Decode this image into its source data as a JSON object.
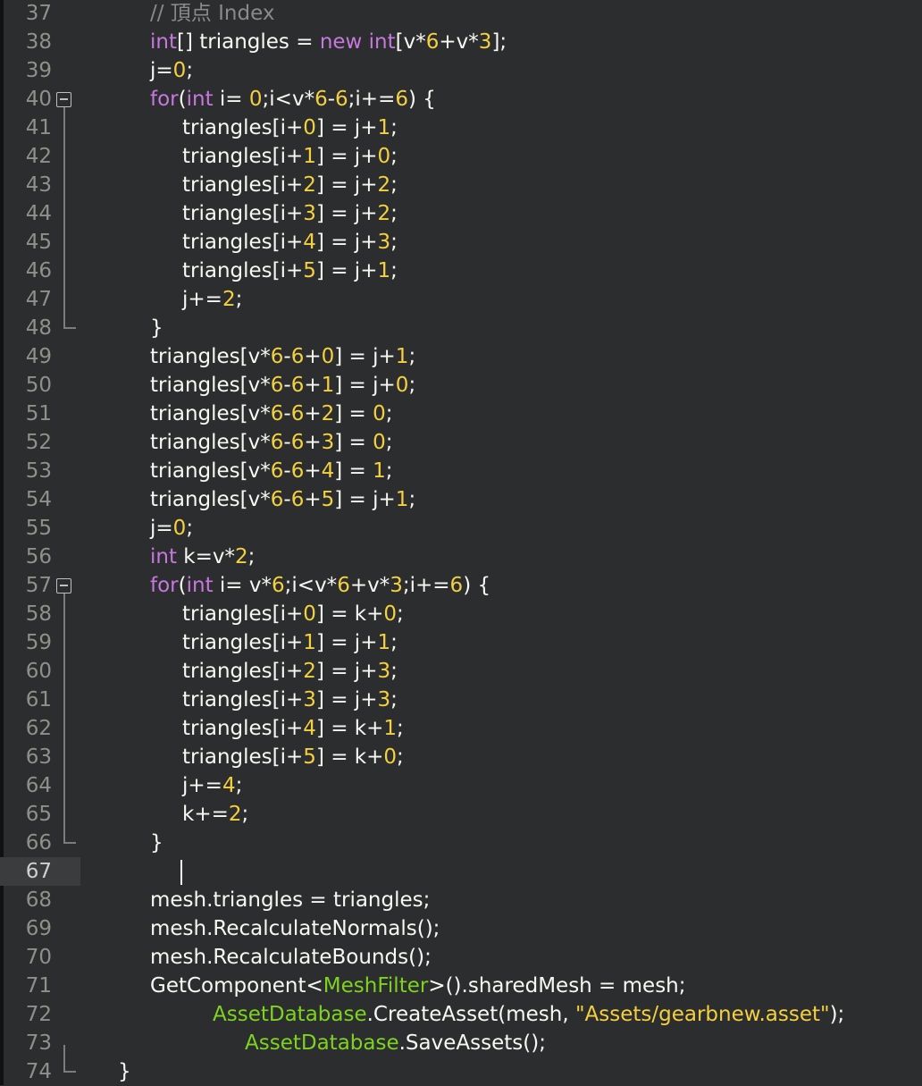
{
  "editor": {
    "current_line": 67,
    "colors": {
      "background": "#2b2d2e",
      "keyword": "#c678dd",
      "number": "#f4d03f",
      "class": "#7ed321",
      "comment": "#8a8a8a"
    },
    "icons": [
      "fold-collapse-icon"
    ],
    "lines": [
      {
        "n": "37",
        "segs": [
          [
            "cmt",
            "// 頂点 Index"
          ]
        ]
      },
      {
        "n": "38",
        "segs": [
          [
            "kw",
            "int"
          ],
          [
            "t",
            "[] triangles = "
          ],
          [
            "kw",
            "new"
          ],
          [
            "t",
            " "
          ],
          [
            "kw",
            "int"
          ],
          [
            "t",
            "[v*"
          ],
          [
            "num",
            "6"
          ],
          [
            "t",
            "+v*"
          ],
          [
            "num",
            "3"
          ],
          [
            "t",
            "];"
          ]
        ]
      },
      {
        "n": "39",
        "segs": [
          [
            "t",
            "j="
          ],
          [
            "num",
            "0"
          ],
          [
            "t",
            ";"
          ]
        ]
      },
      {
        "n": "40",
        "segs": [
          [
            "kw",
            "for"
          ],
          [
            "t",
            "("
          ],
          [
            "kw",
            "int"
          ],
          [
            "t",
            " i= "
          ],
          [
            "num",
            "0"
          ],
          [
            "t",
            ";i<v*"
          ],
          [
            "num",
            "6"
          ],
          [
            "t",
            "-"
          ],
          [
            "num",
            "6"
          ],
          [
            "t",
            ";i+="
          ],
          [
            "num",
            "6"
          ],
          [
            "t",
            ") {"
          ]
        ]
      },
      {
        "n": "41",
        "segs": [
          [
            "t",
            "triangles[i+"
          ],
          [
            "num",
            "0"
          ],
          [
            "t",
            "] = j+"
          ],
          [
            "num",
            "1"
          ],
          [
            "t",
            ";"
          ]
        ]
      },
      {
        "n": "42",
        "segs": [
          [
            "t",
            "triangles[i+"
          ],
          [
            "num",
            "1"
          ],
          [
            "t",
            "] = j+"
          ],
          [
            "num",
            "0"
          ],
          [
            "t",
            ";"
          ]
        ]
      },
      {
        "n": "43",
        "segs": [
          [
            "t",
            "triangles[i+"
          ],
          [
            "num",
            "2"
          ],
          [
            "t",
            "] = j+"
          ],
          [
            "num",
            "2"
          ],
          [
            "t",
            ";"
          ]
        ]
      },
      {
        "n": "44",
        "segs": [
          [
            "t",
            "triangles[i+"
          ],
          [
            "num",
            "3"
          ],
          [
            "t",
            "] = j+"
          ],
          [
            "num",
            "2"
          ],
          [
            "t",
            ";"
          ]
        ]
      },
      {
        "n": "45",
        "segs": [
          [
            "t",
            "triangles[i+"
          ],
          [
            "num",
            "4"
          ],
          [
            "t",
            "] = j+"
          ],
          [
            "num",
            "3"
          ],
          [
            "t",
            ";"
          ]
        ]
      },
      {
        "n": "46",
        "segs": [
          [
            "t",
            "triangles[i+"
          ],
          [
            "num",
            "5"
          ],
          [
            "t",
            "] = j+"
          ],
          [
            "num",
            "1"
          ],
          [
            "t",
            ";"
          ]
        ]
      },
      {
        "n": "47",
        "segs": [
          [
            "t",
            "j+="
          ],
          [
            "num",
            "2"
          ],
          [
            "t",
            ";"
          ]
        ]
      },
      {
        "n": "48",
        "segs": [
          [
            "t",
            "}"
          ]
        ]
      },
      {
        "n": "49",
        "segs": [
          [
            "t",
            "triangles[v*"
          ],
          [
            "num",
            "6"
          ],
          [
            "t",
            "-"
          ],
          [
            "num",
            "6"
          ],
          [
            "t",
            "+"
          ],
          [
            "num",
            "0"
          ],
          [
            "t",
            "] = j+"
          ],
          [
            "num",
            "1"
          ],
          [
            "t",
            ";"
          ]
        ]
      },
      {
        "n": "50",
        "segs": [
          [
            "t",
            "triangles[v*"
          ],
          [
            "num",
            "6"
          ],
          [
            "t",
            "-"
          ],
          [
            "num",
            "6"
          ],
          [
            "t",
            "+"
          ],
          [
            "num",
            "1"
          ],
          [
            "t",
            "] = j+"
          ],
          [
            "num",
            "0"
          ],
          [
            "t",
            ";"
          ]
        ]
      },
      {
        "n": "51",
        "segs": [
          [
            "t",
            "triangles[v*"
          ],
          [
            "num",
            "6"
          ],
          [
            "t",
            "-"
          ],
          [
            "num",
            "6"
          ],
          [
            "t",
            "+"
          ],
          [
            "num",
            "2"
          ],
          [
            "t",
            "] = "
          ],
          [
            "num",
            "0"
          ],
          [
            "t",
            ";"
          ]
        ]
      },
      {
        "n": "52",
        "segs": [
          [
            "t",
            "triangles[v*"
          ],
          [
            "num",
            "6"
          ],
          [
            "t",
            "-"
          ],
          [
            "num",
            "6"
          ],
          [
            "t",
            "+"
          ],
          [
            "num",
            "3"
          ],
          [
            "t",
            "] = "
          ],
          [
            "num",
            "0"
          ],
          [
            "t",
            ";"
          ]
        ]
      },
      {
        "n": "53",
        "segs": [
          [
            "t",
            "triangles[v*"
          ],
          [
            "num",
            "6"
          ],
          [
            "t",
            "-"
          ],
          [
            "num",
            "6"
          ],
          [
            "t",
            "+"
          ],
          [
            "num",
            "4"
          ],
          [
            "t",
            "] = "
          ],
          [
            "num",
            "1"
          ],
          [
            "t",
            ";"
          ]
        ]
      },
      {
        "n": "54",
        "segs": [
          [
            "t",
            "triangles[v*"
          ],
          [
            "num",
            "6"
          ],
          [
            "t",
            "-"
          ],
          [
            "num",
            "6"
          ],
          [
            "t",
            "+"
          ],
          [
            "num",
            "5"
          ],
          [
            "t",
            "] = j+"
          ],
          [
            "num",
            "1"
          ],
          [
            "t",
            ";"
          ]
        ]
      },
      {
        "n": "55",
        "segs": [
          [
            "t",
            "j="
          ],
          [
            "num",
            "0"
          ],
          [
            "t",
            ";"
          ]
        ]
      },
      {
        "n": "56",
        "segs": [
          [
            "kw",
            "int"
          ],
          [
            "t",
            " k=v*"
          ],
          [
            "num",
            "2"
          ],
          [
            "t",
            ";"
          ]
        ]
      },
      {
        "n": "57",
        "segs": [
          [
            "kw",
            "for"
          ],
          [
            "t",
            "("
          ],
          [
            "kw",
            "int"
          ],
          [
            "t",
            " i= v*"
          ],
          [
            "num",
            "6"
          ],
          [
            "t",
            ";i<v*"
          ],
          [
            "num",
            "6"
          ],
          [
            "t",
            "+v*"
          ],
          [
            "num",
            "3"
          ],
          [
            "t",
            ";i+="
          ],
          [
            "num",
            "6"
          ],
          [
            "t",
            ") {"
          ]
        ]
      },
      {
        "n": "58",
        "segs": [
          [
            "t",
            "triangles[i+"
          ],
          [
            "num",
            "0"
          ],
          [
            "t",
            "] = k+"
          ],
          [
            "num",
            "0"
          ],
          [
            "t",
            ";"
          ]
        ]
      },
      {
        "n": "59",
        "segs": [
          [
            "t",
            "triangles[i+"
          ],
          [
            "num",
            "1"
          ],
          [
            "t",
            "] = j+"
          ],
          [
            "num",
            "1"
          ],
          [
            "t",
            ";"
          ]
        ]
      },
      {
        "n": "60",
        "segs": [
          [
            "t",
            "triangles[i+"
          ],
          [
            "num",
            "2"
          ],
          [
            "t",
            "] = j+"
          ],
          [
            "num",
            "3"
          ],
          [
            "t",
            ";"
          ]
        ]
      },
      {
        "n": "61",
        "segs": [
          [
            "t",
            "triangles[i+"
          ],
          [
            "num",
            "3"
          ],
          [
            "t",
            "] = j+"
          ],
          [
            "num",
            "3"
          ],
          [
            "t",
            ";"
          ]
        ]
      },
      {
        "n": "62",
        "segs": [
          [
            "t",
            "triangles[i+"
          ],
          [
            "num",
            "4"
          ],
          [
            "t",
            "] = k+"
          ],
          [
            "num",
            "1"
          ],
          [
            "t",
            ";"
          ]
        ]
      },
      {
        "n": "63",
        "segs": [
          [
            "t",
            "triangles[i+"
          ],
          [
            "num",
            "5"
          ],
          [
            "t",
            "] = k+"
          ],
          [
            "num",
            "0"
          ],
          [
            "t",
            ";"
          ]
        ]
      },
      {
        "n": "64",
        "segs": [
          [
            "t",
            "j+="
          ],
          [
            "num",
            "4"
          ],
          [
            "t",
            ";"
          ]
        ]
      },
      {
        "n": "65",
        "segs": [
          [
            "t",
            "k+="
          ],
          [
            "num",
            "2"
          ],
          [
            "t",
            ";"
          ]
        ]
      },
      {
        "n": "66",
        "segs": [
          [
            "t",
            "}"
          ]
        ]
      },
      {
        "n": "67",
        "segs": []
      },
      {
        "n": "68",
        "segs": [
          [
            "t",
            "mesh.triangles = triangles;"
          ]
        ]
      },
      {
        "n": "69",
        "segs": [
          [
            "t",
            "mesh.RecalculateNormals();"
          ]
        ]
      },
      {
        "n": "70",
        "segs": [
          [
            "t",
            "mesh.RecalculateBounds();"
          ]
        ]
      },
      {
        "n": "71",
        "segs": [
          [
            "t",
            "GetComponent<"
          ],
          [
            "cls",
            "MeshFilter"
          ],
          [
            "t",
            ">().sharedMesh = mesh;"
          ]
        ]
      },
      {
        "n": "72",
        "segs": [
          [
            "cls",
            "AssetDatabase"
          ],
          [
            "t",
            ".CreateAsset(mesh, "
          ],
          [
            "str",
            "\"Assets/gearbnew.asset\""
          ],
          [
            "t",
            ");"
          ]
        ]
      },
      {
        "n": "73",
        "segs": [
          [
            "cls",
            "AssetDatabase"
          ],
          [
            "t",
            ".SaveAssets();"
          ]
        ]
      },
      {
        "n": "74",
        "segs": [
          [
            "t",
            "}"
          ]
        ]
      }
    ]
  }
}
